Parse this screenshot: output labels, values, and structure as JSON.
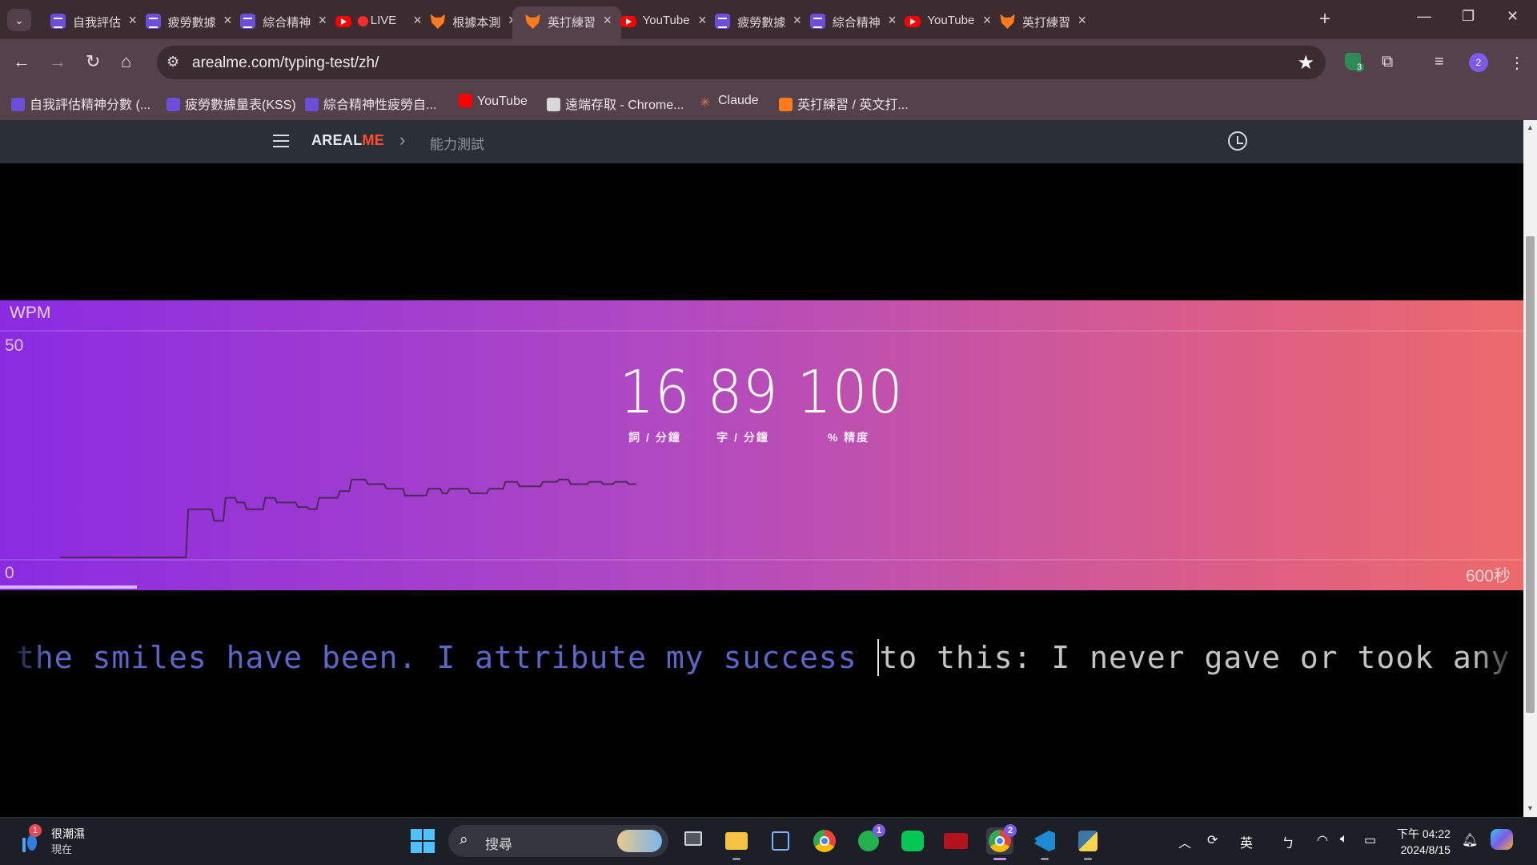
{
  "browser": {
    "tabs": [
      {
        "title": "自我評估精",
        "icon": "doc-icon",
        "active": false
      },
      {
        "title": "疲勞數據",
        "icon": "doc-icon",
        "active": false
      },
      {
        "title": "綜合精神",
        "icon": "doc-icon",
        "active": false
      },
      {
        "title": "LIVE",
        "icon": "youtube-icon",
        "active": false
      },
      {
        "title": "根據本測",
        "icon": "fox-icon",
        "active": false
      },
      {
        "title": "英打練習",
        "icon": "fox-icon",
        "active": true
      },
      {
        "title": "YouTube",
        "icon": "youtube-icon",
        "active": false
      },
      {
        "title": "疲勞數據",
        "icon": "doc-icon",
        "active": false
      },
      {
        "title": "綜合精神",
        "icon": "doc-icon",
        "active": false
      },
      {
        "title": "YouTube",
        "icon": "youtube-icon",
        "active": false
      },
      {
        "title": "英打練習",
        "icon": "fox-icon",
        "active": false
      }
    ],
    "url": "arealme.com/typing-test/zh/",
    "extension_badge": "3",
    "profile_badge": "2",
    "bookmarks": [
      {
        "label": "自我評估精神分數 (...",
        "icon": "doc-icon"
      },
      {
        "label": "疲勞數據量表(KSS)",
        "icon": "doc-icon"
      },
      {
        "label": "綜合精神性疲勞自...",
        "icon": "doc-icon"
      },
      {
        "label": "YouTube",
        "icon": "youtube-icon"
      },
      {
        "label": "遠端存取 - Chrome...",
        "icon": "remote-icon"
      },
      {
        "label": "Claude",
        "icon": "claude-icon"
      },
      {
        "label": "英打練習 / 英文打...",
        "icon": "fox-icon"
      }
    ]
  },
  "site": {
    "logo_a": "AREAL",
    "logo_b": "ME",
    "breadcrumb_sep": "›",
    "breadcrumb": "能力測試"
  },
  "results": {
    "wpm_label": "WPM",
    "y_max": "50",
    "y_min": "0",
    "x_max": "600秒",
    "stats": [
      {
        "value": "16",
        "label": "詞 / 分鐘"
      },
      {
        "value": "89",
        "label": "字 / 分鐘"
      },
      {
        "value": "100",
        "label": "% 精度"
      }
    ],
    "progress_fraction": 0.09
  },
  "chart_data": {
    "type": "line",
    "ylabel": "WPM",
    "xlim": [
      0,
      600
    ],
    "ylim": [
      0,
      50
    ],
    "x_max_label": "600秒",
    "series": [
      {
        "points": [
          [
            0,
            0
          ],
          [
            54,
            0
          ],
          [
            55,
            10.5
          ],
          [
            65,
            10.5
          ],
          [
            66,
            8
          ],
          [
            70,
            8
          ],
          [
            71,
            13
          ],
          [
            75,
            13
          ],
          [
            76,
            12
          ],
          [
            79,
            12
          ],
          [
            80,
            10.5
          ],
          [
            87,
            10.5
          ],
          [
            88,
            13
          ],
          [
            92,
            13
          ],
          [
            93,
            12
          ],
          [
            101,
            12
          ],
          [
            102,
            11
          ],
          [
            106,
            11
          ],
          [
            107,
            10.5
          ],
          [
            110,
            10.5
          ],
          [
            111,
            13
          ],
          [
            119,
            13
          ],
          [
            120,
            14.5
          ],
          [
            124,
            14.5
          ],
          [
            125,
            17
          ],
          [
            131,
            17
          ],
          [
            132,
            16
          ],
          [
            139,
            16
          ],
          [
            140,
            15
          ],
          [
            147,
            15
          ],
          [
            148,
            13.5
          ],
          [
            157,
            13.5
          ],
          [
            158,
            15
          ],
          [
            163,
            15
          ],
          [
            164,
            14
          ],
          [
            166,
            14
          ],
          [
            167,
            15
          ],
          [
            175,
            15
          ],
          [
            176,
            14
          ],
          [
            183,
            14
          ],
          [
            184,
            15
          ],
          [
            190,
            15
          ],
          [
            191,
            16.5
          ],
          [
            196,
            16.5
          ],
          [
            197,
            15.5
          ],
          [
            206,
            15.5
          ],
          [
            207,
            16.5
          ],
          [
            213,
            16.5
          ],
          [
            214,
            17
          ],
          [
            218,
            17
          ],
          [
            219,
            16
          ],
          [
            226,
            16
          ],
          [
            227,
            16.5
          ],
          [
            232,
            16.5
          ],
          [
            233,
            16
          ],
          [
            237,
            16
          ],
          [
            238,
            16.5
          ],
          [
            243,
            16.5
          ],
          [
            244,
            16
          ],
          [
            247,
            16
          ]
        ],
        "x_scale_note": "time in seconds"
      }
    ]
  },
  "typing": {
    "typed_text": "the smiles have been. I attribute my success ",
    "pending_text": "to this: I never gave or took any excuse. Do not"
  },
  "taskbar": {
    "weather_title": "很潮濕",
    "weather_sub": "現在",
    "weather_badge": "1",
    "search_placeholder": "搜尋",
    "xbox_badge": "1",
    "chrome_badge": "2",
    "ime_lang": "英",
    "ime_mode": "ㄅ",
    "time": "下午 04:22",
    "date": "2024/8/15"
  }
}
